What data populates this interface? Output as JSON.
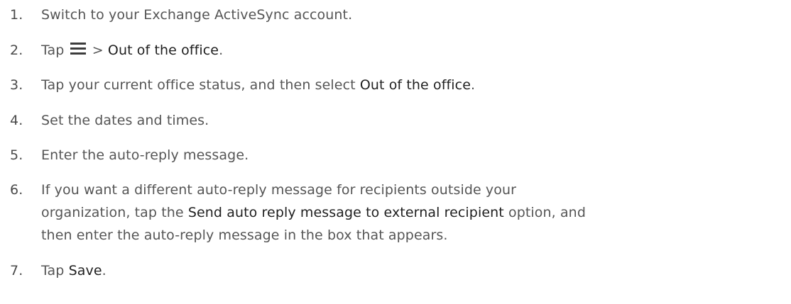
{
  "steps": [
    {
      "number": "1.",
      "text": "Switch to your Exchange ActiveSync account."
    },
    {
      "number": "2.",
      "prefix": "Tap",
      "icon": "menu-icon",
      "separator": ">",
      "bold": "Out of the office",
      "suffix": "."
    },
    {
      "number": "3.",
      "prefix": "Tap your current office status, and then select",
      "bold": "Out of the office",
      "suffix": "."
    },
    {
      "number": "4.",
      "text": "Set the dates and times."
    },
    {
      "number": "5.",
      "text": "Enter the auto-reply message."
    },
    {
      "number": "6.",
      "line1": "If you want a different auto-reply message for recipients outside your",
      "line2_prefix": "organization, tap the",
      "line2_bold": "Send auto reply message to external recipient",
      "line2_suffix": "option, and",
      "line3": "then enter the auto-reply message in the box that appears."
    },
    {
      "number": "7.",
      "prefix": "Tap",
      "bold": "Save",
      "suffix": "."
    }
  ],
  "colors": {
    "text": "#555555",
    "number": "#4a4a4a",
    "emphasis": "#1f1f1f",
    "background": "#ffffff"
  }
}
